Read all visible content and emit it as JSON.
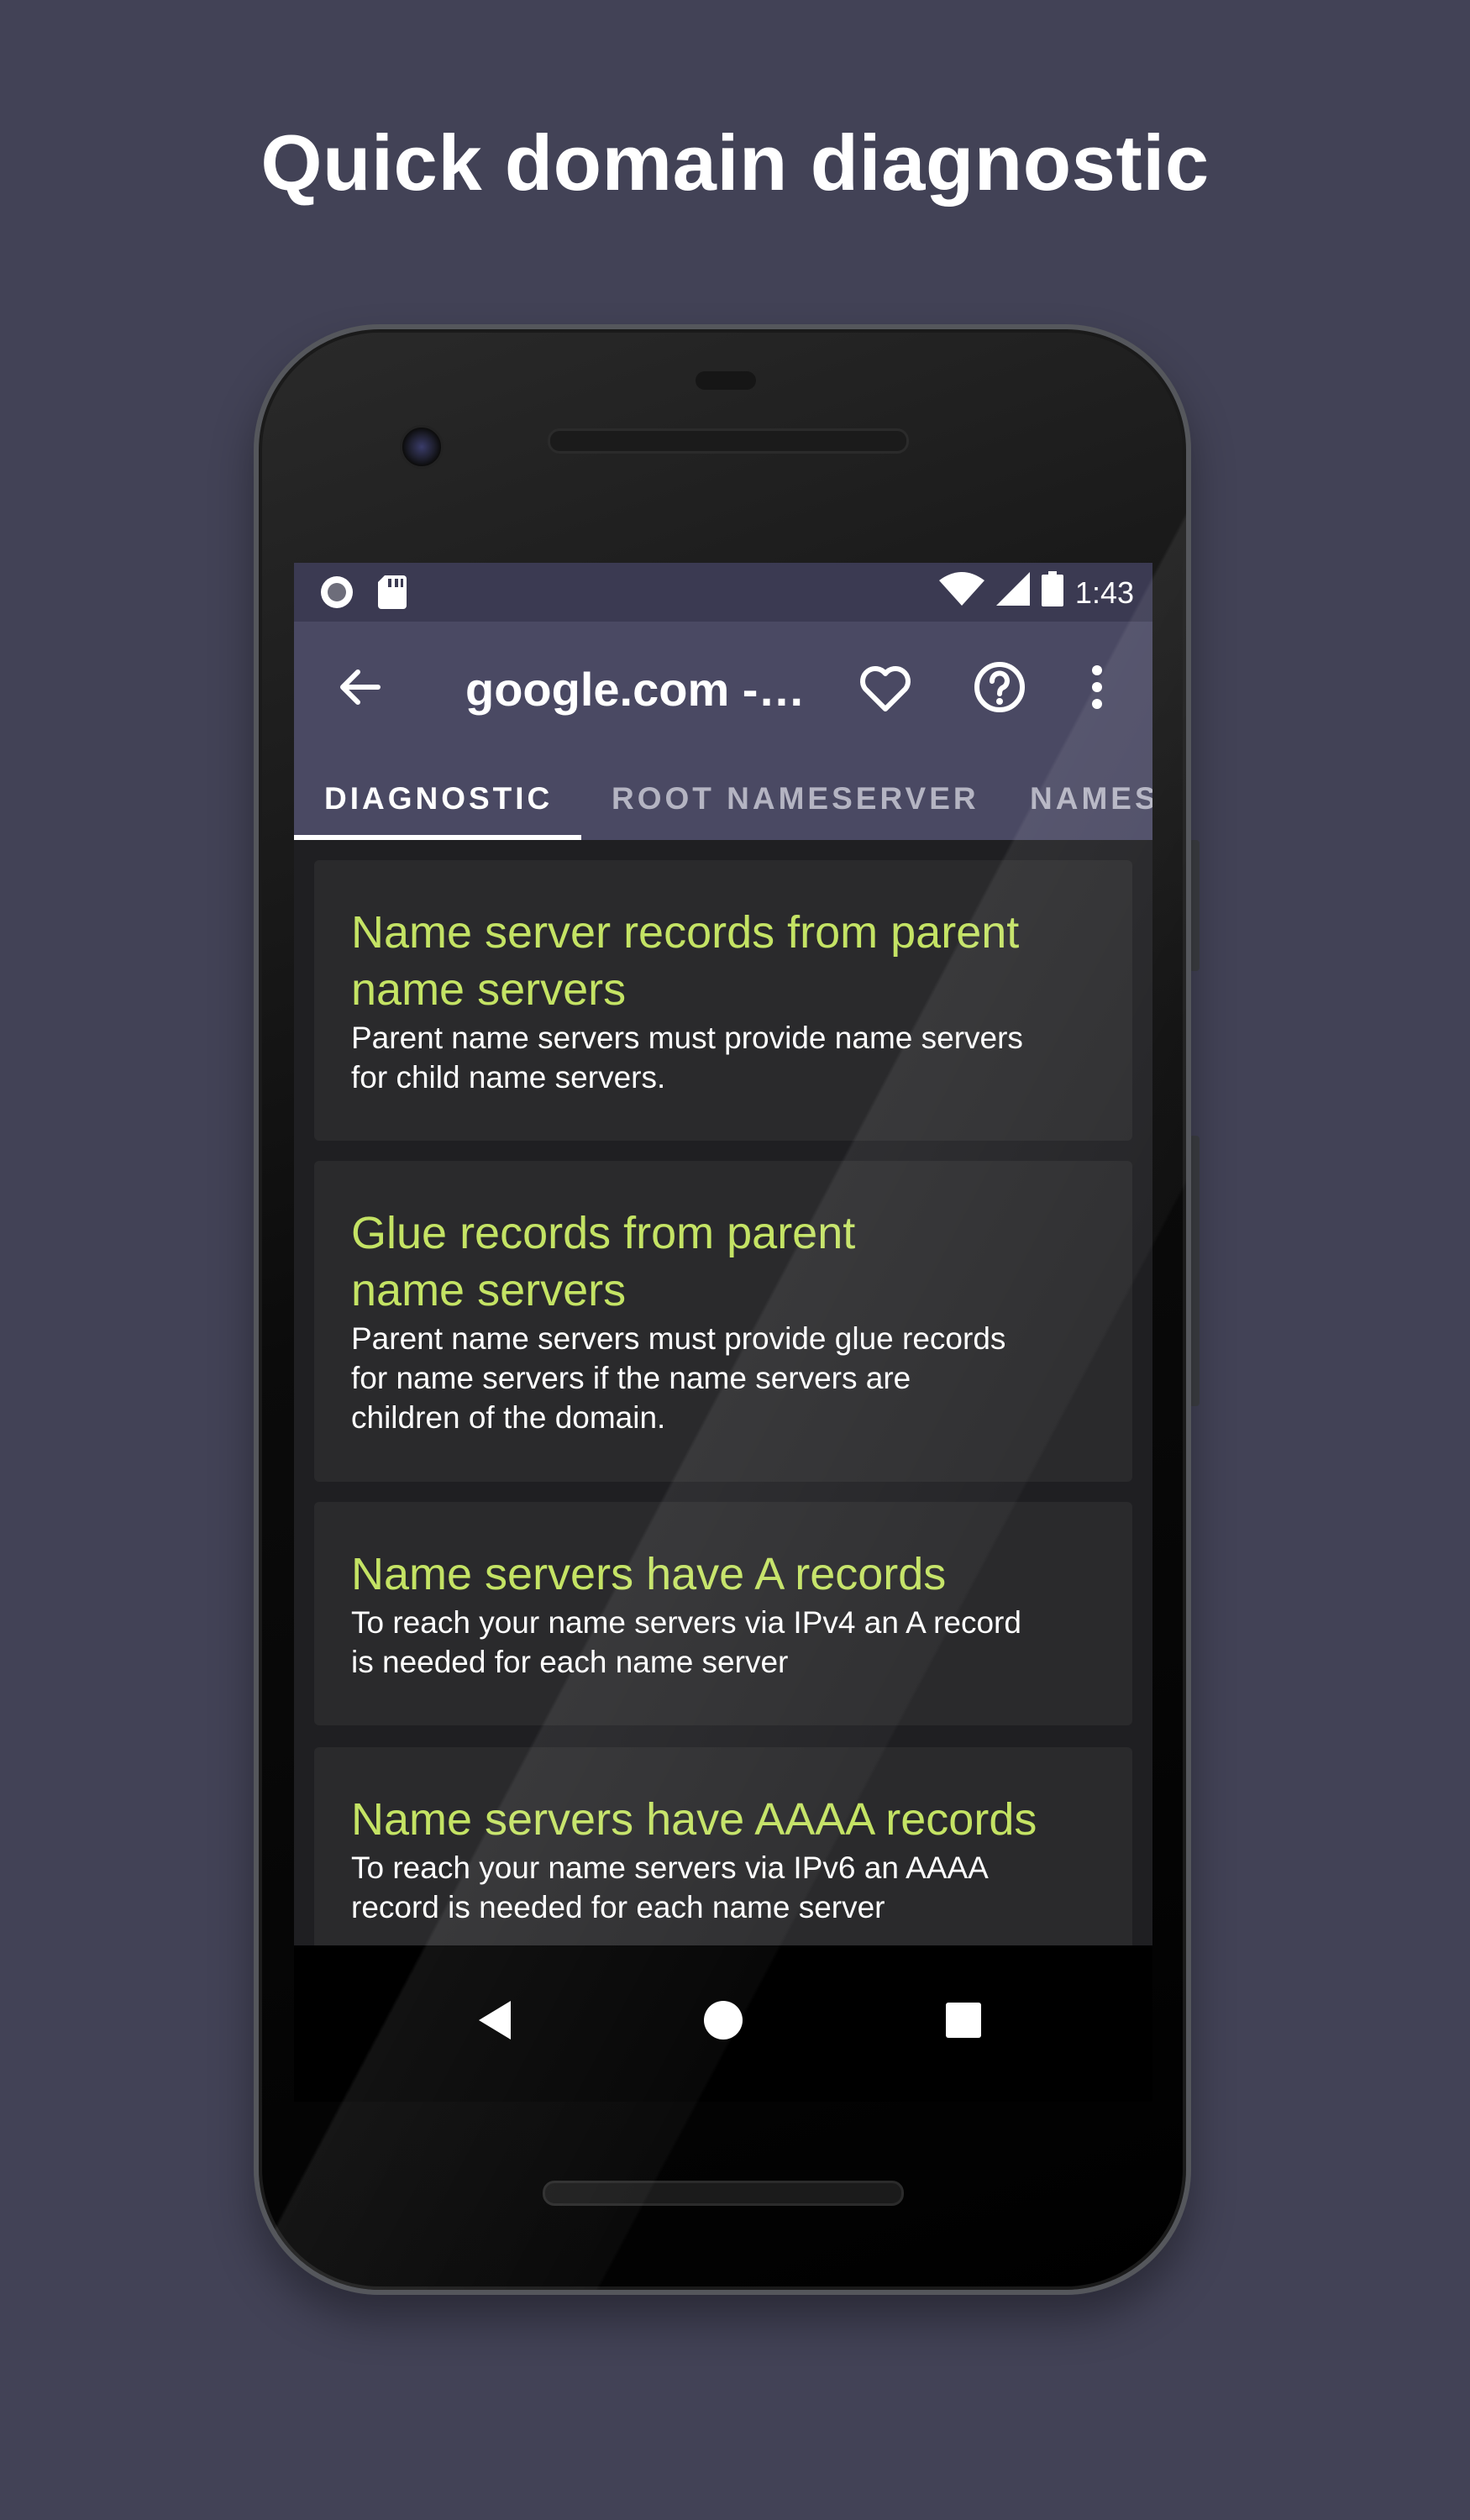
{
  "headline": "Quick domain diagnostic",
  "status_bar": {
    "time": "1:43",
    "icons": [
      "circle-notification-icon",
      "sd-card-icon",
      "wifi-icon",
      "cell-signal-icon",
      "battery-icon"
    ]
  },
  "app_bar": {
    "title": "google.com -…",
    "icons": [
      "arrow-back-icon",
      "heart-icon",
      "help-icon",
      "more-vert-icon"
    ]
  },
  "tabs": [
    {
      "label": "DIAGNOSTIC",
      "active": true
    },
    {
      "label": "ROOT NAMESERVER",
      "active": false
    },
    {
      "label": "NAMES",
      "active": false
    }
  ],
  "cards": [
    {
      "title_lines": [
        "Name server records from parent",
        "name servers"
      ],
      "desc_lines": [
        "Parent name servers must provide name servers",
        "for child name servers."
      ]
    },
    {
      "title_lines": [
        "Glue records from parent",
        "name servers"
      ],
      "desc_lines": [
        "Parent name servers must provide glue records",
        "for name servers if the name servers are",
        "children of the domain."
      ]
    },
    {
      "title_lines": [
        "Name servers have A records"
      ],
      "desc_lines": [
        "To reach your name servers via IPv4 an A record",
        "is needed for each name server"
      ]
    },
    {
      "title_lines": [
        "Name servers have AAAA records"
      ],
      "desc_lines": [
        "To reach your name servers via IPv6 an AAAA",
        "record is needed for each name server"
      ]
    }
  ],
  "nav_bar": {
    "icons": [
      "nav-back-icon",
      "nav-home-icon",
      "nav-recents-icon"
    ]
  },
  "colors": {
    "background": "#424256",
    "app_bar": "#4a4963",
    "status_bar": "#3b3a52",
    "card_title": "#c4e364",
    "card_background": "#2a2a2c"
  }
}
